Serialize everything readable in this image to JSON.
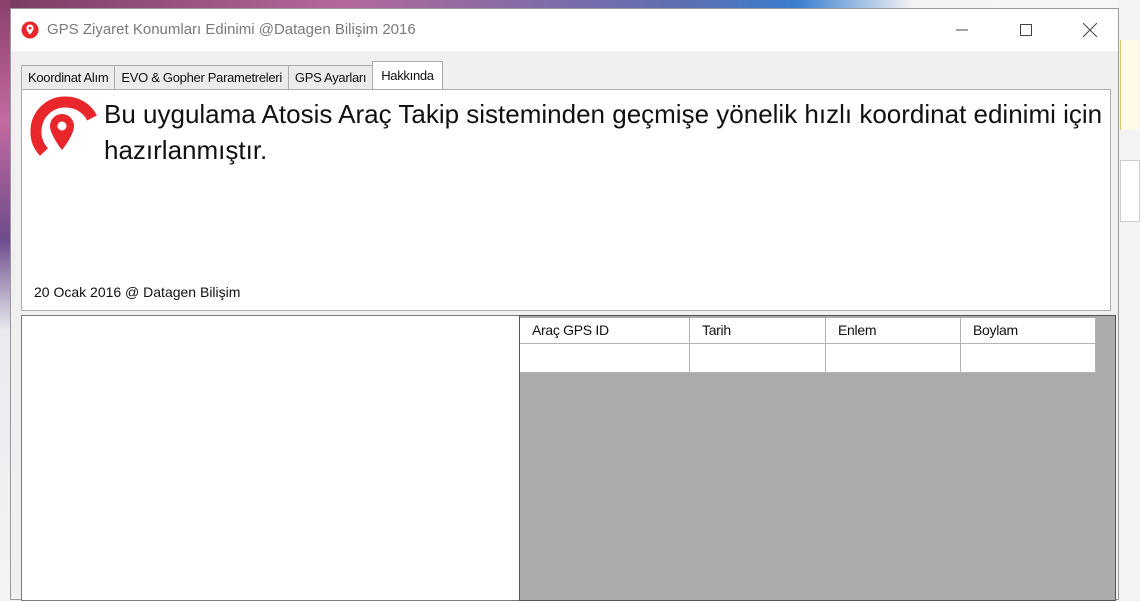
{
  "window": {
    "title": "GPS Ziyaret Konumları Edinimi @Datagen Bilişim 2016"
  },
  "tabs": [
    {
      "label": "Koordinat Alım",
      "active": false
    },
    {
      "label": "EVO & Gopher Parametreleri",
      "active": false
    },
    {
      "label": "GPS Ayarları",
      "active": false
    },
    {
      "label": "Hakkında",
      "active": true
    }
  ],
  "about": {
    "description": "Bu uygulama Atosis Araç Takip sisteminden geçmişe yönelik hızlı koordinat edinimi için hazırlanmıştır.",
    "footer": "20 Ocak 2016 @ Datagen Bilişim"
  },
  "grid": {
    "columns": [
      "Araç GPS ID",
      "Tarih",
      "Enlem",
      "Boylam"
    ],
    "rows": [
      [
        "",
        "",
        "",
        ""
      ]
    ]
  },
  "colors": {
    "brand_red": "#e8262b",
    "grid_background": "#ababab"
  },
  "icons": {
    "app": "map-pin-icon",
    "logo": "map-pin-logo-icon",
    "minimize": "minimize-icon",
    "maximize": "maximize-icon",
    "close": "close-icon"
  }
}
